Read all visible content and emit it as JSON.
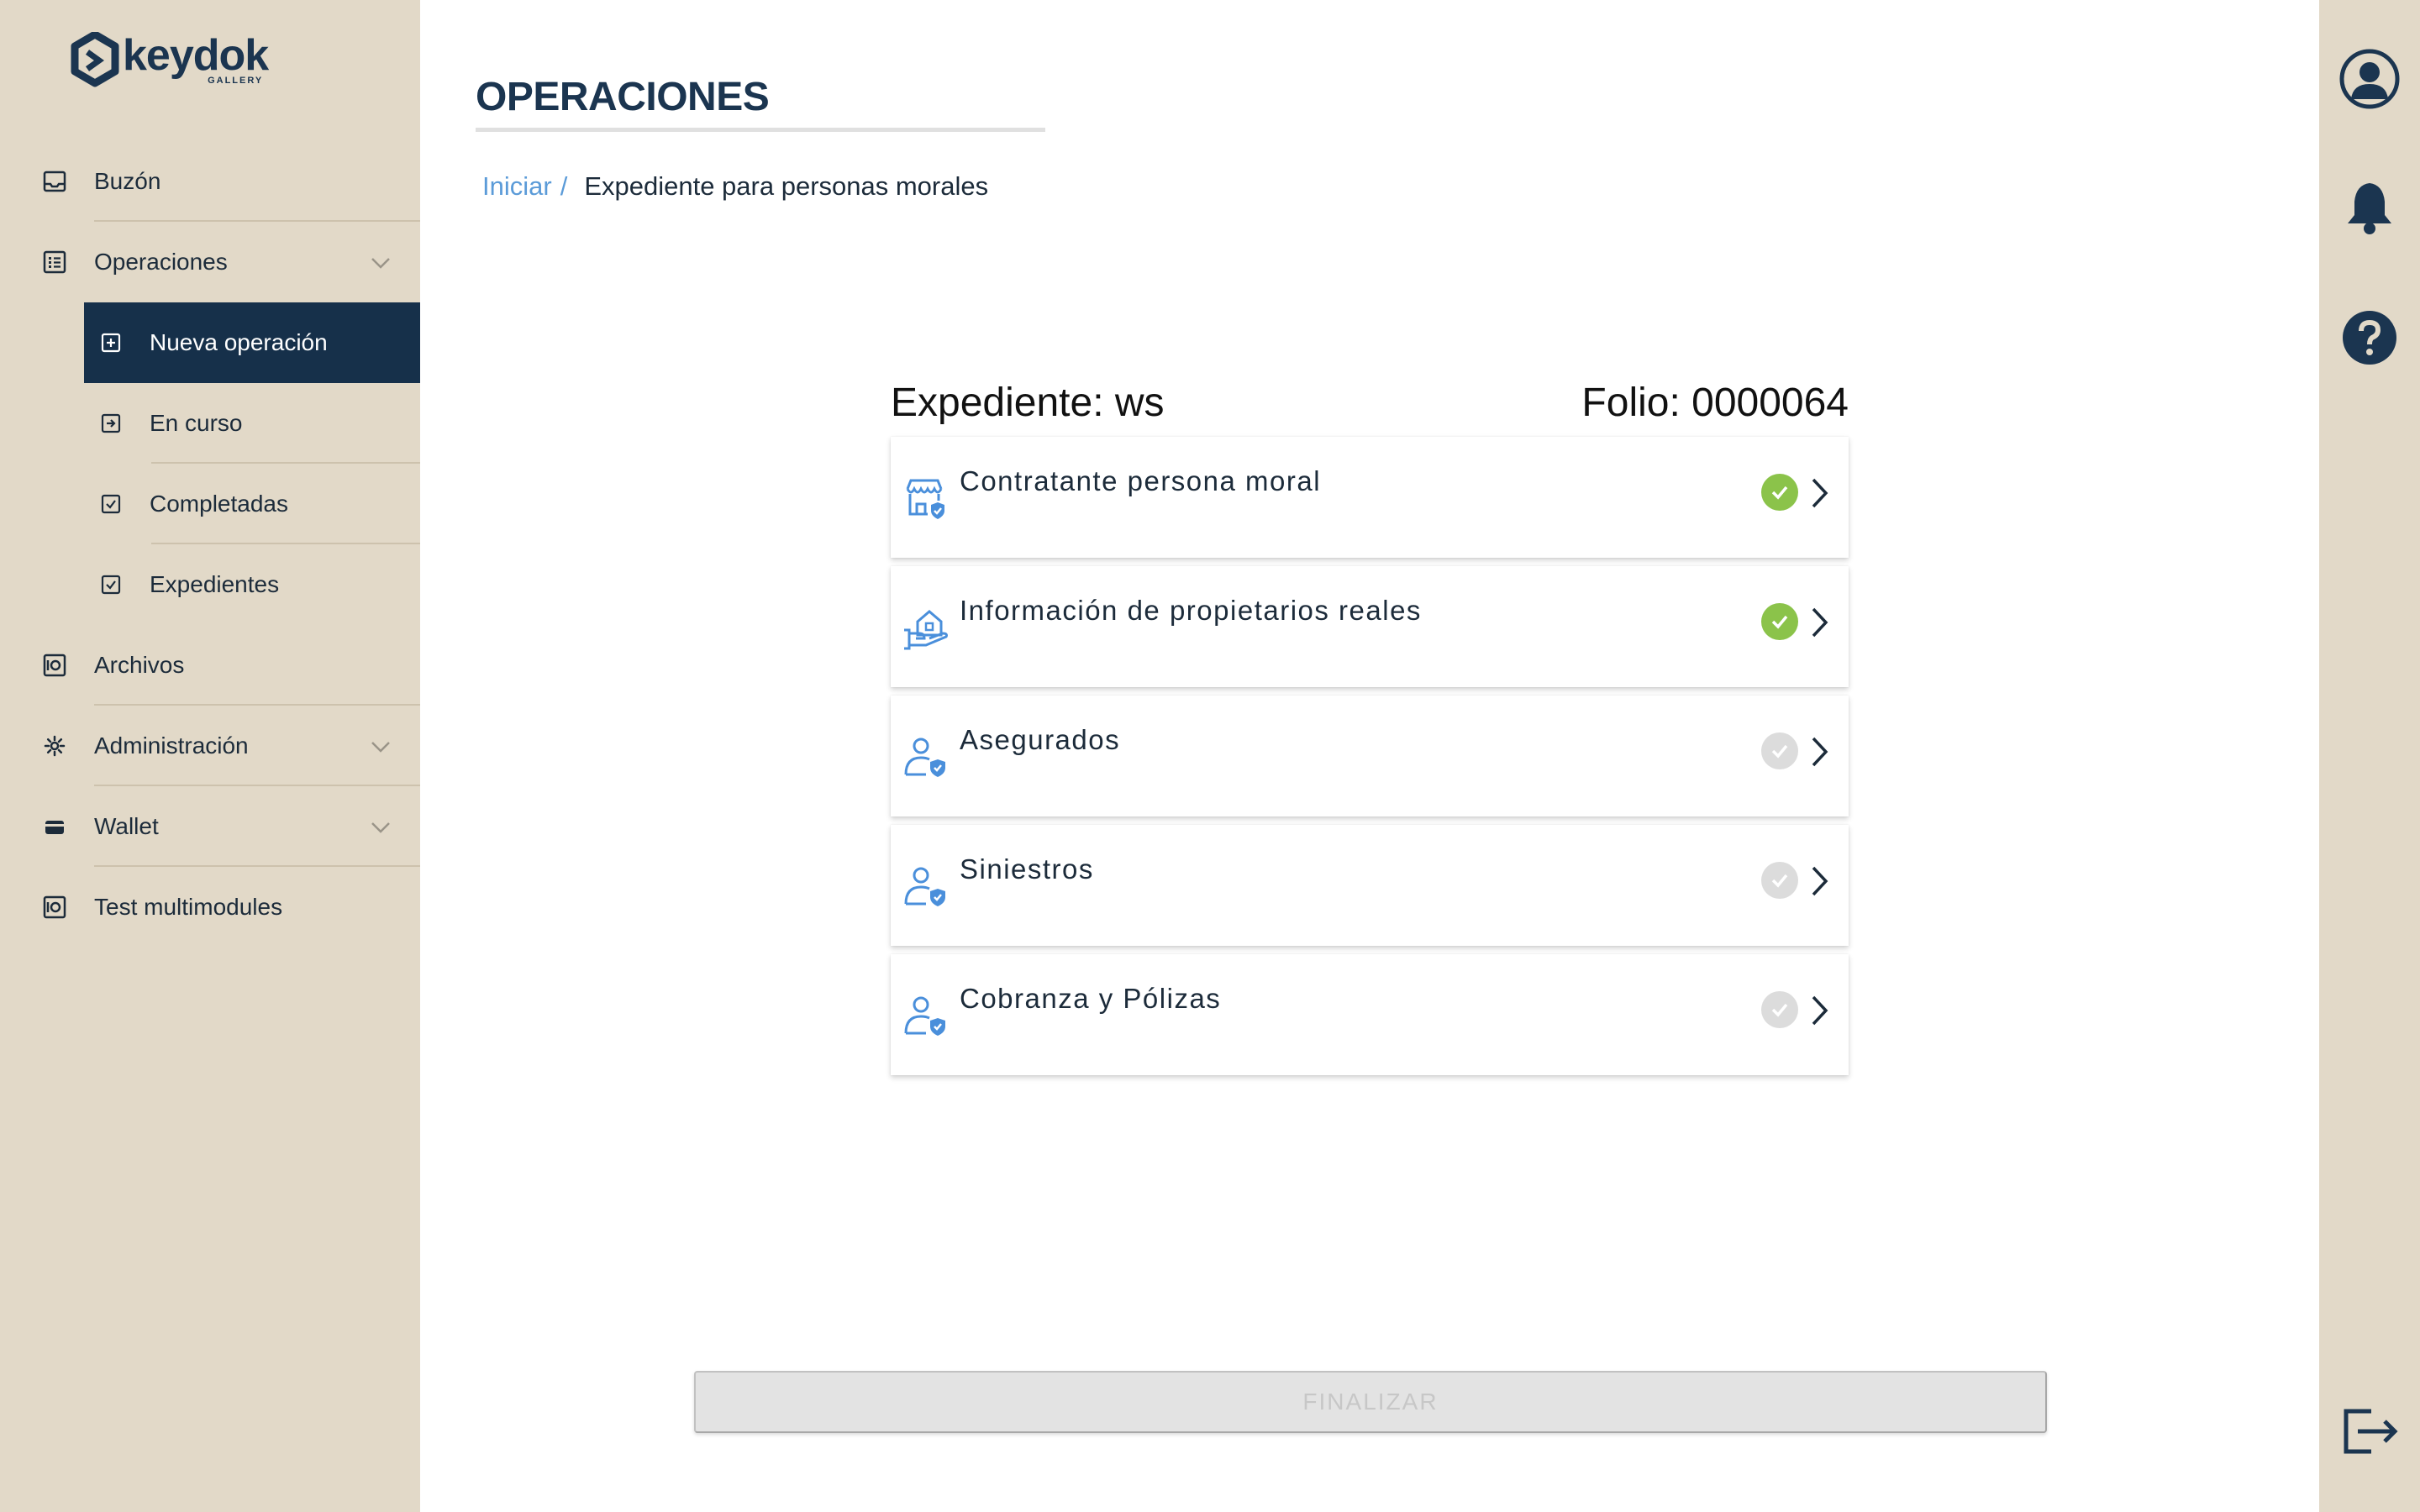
{
  "brand": {
    "name": "keydok",
    "tagline": "GALLERY"
  },
  "sidebar": {
    "items": [
      {
        "label": "Buzón",
        "icon": "inbox-icon"
      },
      {
        "label": "Operaciones",
        "icon": "list-icon",
        "expanded": true,
        "children": [
          {
            "label": "Nueva operación",
            "icon": "plus-square-icon",
            "active": true
          },
          {
            "label": "En curso",
            "icon": "enter-square-icon"
          },
          {
            "label": "Completadas",
            "icon": "check-square-icon"
          },
          {
            "label": "Expedientes",
            "icon": "check-square-icon"
          }
        ]
      },
      {
        "label": "Archivos",
        "icon": "safe-icon"
      },
      {
        "label": "Administración",
        "icon": "gear-icon"
      },
      {
        "label": "Wallet",
        "icon": "wallet-icon"
      },
      {
        "label": "Test multimodules",
        "icon": "safe-icon"
      }
    ]
  },
  "header": {
    "title": "OPERACIONES"
  },
  "breadcrumb": {
    "root": "Iniciar",
    "separator": "/",
    "current": "Expediente para personas morales"
  },
  "expediente": {
    "label": "Expediente: ws",
    "folio": "Folio: 0000064"
  },
  "sections": [
    {
      "label": "Contratante persona moral",
      "icon": "store-shield-icon",
      "status": "complete"
    },
    {
      "label": "Información de propietarios reales",
      "icon": "house-hand-icon",
      "status": "complete"
    },
    {
      "label": "Asegurados",
      "icon": "user-shield-icon",
      "status": "pending"
    },
    {
      "label": "Siniestros",
      "icon": "user-shield-icon",
      "status": "pending"
    },
    {
      "label": "Cobranza y Pólizas",
      "icon": "user-shield-icon",
      "status": "pending"
    }
  ],
  "actions": {
    "finalize": "FINALIZAR"
  },
  "rail": {
    "icons": [
      "user-avatar-icon",
      "bell-icon",
      "help-icon",
      "logout-icon"
    ]
  },
  "colors": {
    "sidebar_bg": "#e2d9c8",
    "active_bg": "#16304a",
    "primary": "#1b3550",
    "link": "#5b9bd8",
    "icon_blue": "#4a8fdb",
    "success": "#8bc34a",
    "pending": "#dcdcdc"
  }
}
